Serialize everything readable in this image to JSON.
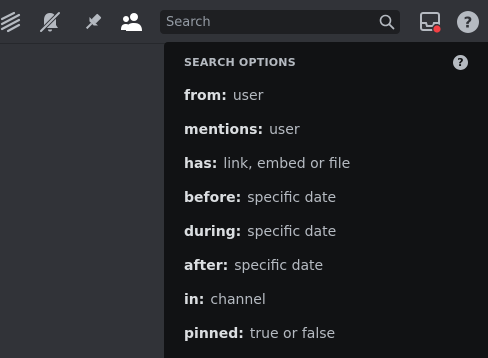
{
  "toolbar": {
    "icons": [
      "threads-icon",
      "notification-settings-muted-icon",
      "pinned-messages-icon",
      "member-list-icon"
    ],
    "inbox_icon": "inbox-icon",
    "help_icon": "help-icon",
    "help_glyph": "?",
    "inbox_badge_color": "#f23f43"
  },
  "search": {
    "placeholder": "Search",
    "value": ""
  },
  "search_options": {
    "title": "SEARCH OPTIONS",
    "help_glyph": "?",
    "items": [
      {
        "key": "from:",
        "hint": "user"
      },
      {
        "key": "mentions:",
        "hint": "user"
      },
      {
        "key": "has:",
        "hint": "link, embed or file"
      },
      {
        "key": "before:",
        "hint": "specific date"
      },
      {
        "key": "during:",
        "hint": "specific date"
      },
      {
        "key": "after:",
        "hint": "specific date"
      },
      {
        "key": "in:",
        "hint": "channel"
      },
      {
        "key": "pinned:",
        "hint": "true or false"
      }
    ]
  }
}
